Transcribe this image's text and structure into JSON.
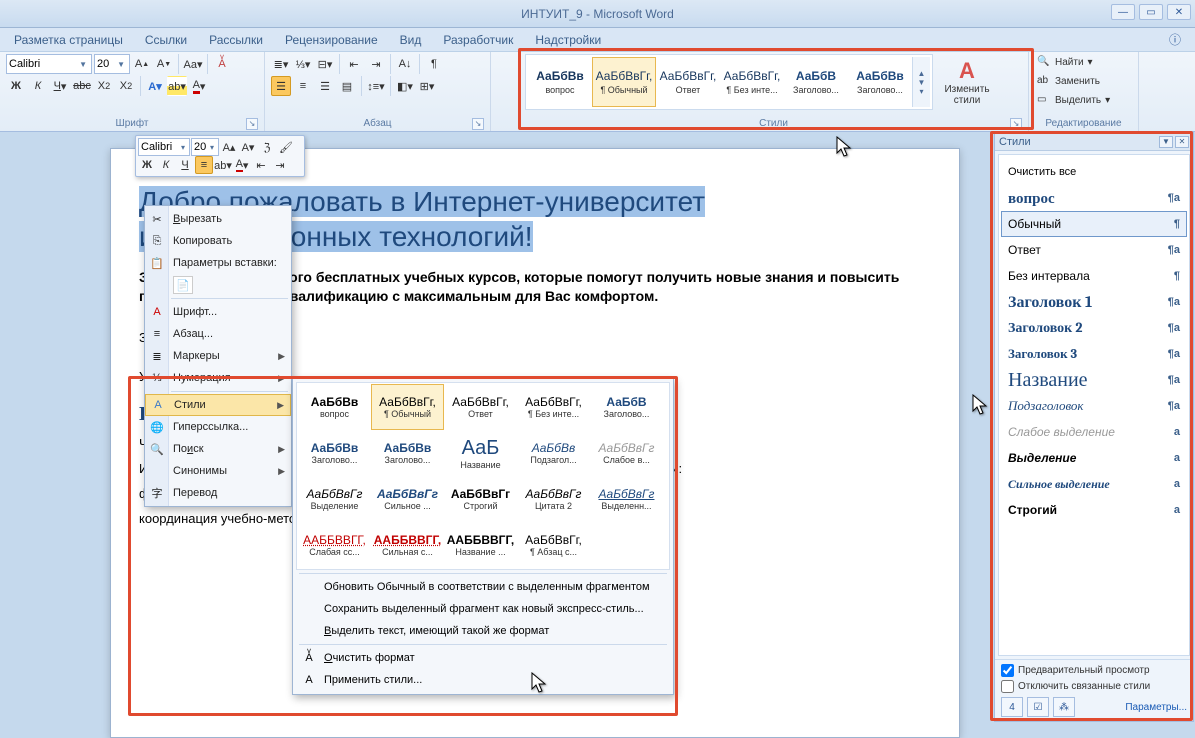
{
  "window": {
    "title": "ИНТУИТ_9 - Microsoft Word"
  },
  "menu": {
    "items": [
      "Разметка страницы",
      "Ссылки",
      "Рассылки",
      "Рецензирование",
      "Вид",
      "Разработчик",
      "Надстройки"
    ]
  },
  "ribbon": {
    "font": {
      "name": "Calibri",
      "size": "20",
      "group": "Шрифт"
    },
    "para": {
      "group": "Абзац"
    },
    "styles": {
      "group": "Стили",
      "items": [
        {
          "prev": "АаБбВв",
          "name": "вопрос",
          "cls": "bbold"
        },
        {
          "prev": "АаБбВвГг,",
          "name": "¶ Обычный",
          "sel": true
        },
        {
          "prev": "АаБбВвГг,",
          "name": "Ответ"
        },
        {
          "prev": "АаБбВвГг,",
          "name": "¶ Без инте..."
        },
        {
          "prev": "АаБбВ",
          "name": "Заголово...",
          "cls": "blue"
        },
        {
          "prev": "АаБбВв",
          "name": "Заголово...",
          "cls": "blue"
        }
      ],
      "change": "Изменить стили"
    },
    "edit": {
      "group": "Редактирование",
      "find": "Найти",
      "replace": "Заменить",
      "select": "Выделить"
    }
  },
  "minitb": {
    "font": "Calibri",
    "size": "20"
  },
  "ctxmenu": {
    "cut": "Вырезать",
    "copy": "Копировать",
    "pasteopt": "Параметры вставки:",
    "font": "Шрифт...",
    "para": "Абзац...",
    "bullets": "Маркеры",
    "numbering": "Нумерация",
    "styles": "Стили",
    "hyperlink": "Гиперссылка...",
    "search": "Поиск",
    "synonyms": "Синонимы",
    "translate": "Перевод"
  },
  "stylesub": {
    "row1": [
      {
        "p": "АаБбВв",
        "n": "вопрос",
        "cls": "fw-b"
      },
      {
        "p": "АаБбВвГг,",
        "n": "¶ Обычный",
        "sel": true
      },
      {
        "p": "АаБбВвГг,",
        "n": "Ответ"
      },
      {
        "p": "АаБбВвГг,",
        "n": "¶ Без инте..."
      },
      {
        "p": "АаБбВ",
        "n": "Заголово...",
        "cls": "c-blue fw-b"
      }
    ],
    "row2": [
      {
        "p": "АаБбВв",
        "n": "Заголово...",
        "cls": "c-blue fw-b"
      },
      {
        "p": "АаБбВв",
        "n": "Заголово...",
        "cls": "c-blue fw-b"
      },
      {
        "p": "АаБ",
        "n": "Название",
        "cls": "c-blue",
        "big": true
      },
      {
        "p": "АаБбВв",
        "n": "Подзагол...",
        "cls": "c-blue it"
      },
      {
        "p": "АаБбВвГг",
        "n": "Слабое в...",
        "cls": "it",
        "grey": true
      }
    ],
    "row3": [
      {
        "p": "АаБбВвГг",
        "n": "Выделение",
        "cls": "it"
      },
      {
        "p": "АаБбВвГг",
        "n": "Сильное ...",
        "cls": "c-blue fw-b it"
      },
      {
        "p": "АаБбВвГг",
        "n": "Строгий",
        "cls": "fw-b"
      },
      {
        "p": "АаБбВвГг",
        "n": "Цитата 2",
        "cls": "it"
      },
      {
        "p": "АаБбВвГг",
        "n": "Выделенн...",
        "cls": "ul c-blue"
      }
    ],
    "row4": [
      {
        "p": "ААББВВГГ,",
        "n": "Слабая сс...",
        "cls": "c-red",
        "under": true
      },
      {
        "p": "ААББВВГГ,",
        "n": "Сильная с...",
        "cls": "c-red fw-b",
        "under": true
      },
      {
        "p": "ААББВВГГ,",
        "n": "Название ...",
        "cls": "fw-b"
      },
      {
        "p": "АаБбВвГг,",
        "n": "¶ Абзац с..."
      }
    ],
    "update": "Обновить Обычный в соответствии с выделенным фрагментом",
    "saveas": "Сохранить выделенный фрагмент как новый экспресс-стиль...",
    "selsame": "Выделить текст, имеющий такой же формат",
    "clear": "Очистить формат",
    "apply": "Применить стили..."
  },
  "doc": {
    "h1a": "Добро пожаловать в Интернет-университет",
    "h1b": "информационных технологий!",
    "p1": "Здесь Вы найдете много бесплатных учебных курсов, которые помогут получить новые знания и повысить профессиональную квалификацию с максимальным для Вас комфортом.",
    "p2": "Зар",
    "p3": "Учи",
    "h2": "Информация о п",
    "p4": "Что такое Интернет-Универ",
    "p5": "Интернет-Университет Инф                                                                  авит следующие цели:",
    "p6": "финансирование разработ                                                                       ых технологий;",
    "p7": "координация учебно-метод"
  },
  "stylespane": {
    "title": "Стили",
    "clear": "Очистить все",
    "items": [
      {
        "n": "вопрос",
        "m": "¶a",
        "cls": "c-blue fw-b",
        "sz": "15px"
      },
      {
        "n": "Обычный",
        "m": "¶",
        "sel": true,
        "sz": "12px"
      },
      {
        "n": "Ответ",
        "m": "¶a",
        "sz": "12px"
      },
      {
        "n": "Без интервала",
        "m": "¶",
        "sz": "12px"
      },
      {
        "n": "Заголовок 1",
        "m": "¶a",
        "cls": "c-blue fw-b",
        "sz": "16px"
      },
      {
        "n": "Заголовок 2",
        "m": "¶a",
        "cls": "c-blue fw-b",
        "sz": "14px"
      },
      {
        "n": "Заголовок 3",
        "m": "¶a",
        "cls": "c-blue fw-b",
        "sz": "13px"
      },
      {
        "n": "Название",
        "m": "¶a",
        "cls": "c-blue",
        "sz": "20px"
      },
      {
        "n": "Подзаголовок",
        "m": "¶a",
        "cls": "c-blue it",
        "sz": "13px"
      },
      {
        "n": "Слабое выделение",
        "m": "a",
        "cls": "it",
        "grey": true,
        "sz": "12px"
      },
      {
        "n": "Выделение",
        "m": "a",
        "cls": "it fw-b",
        "sz": "12px"
      },
      {
        "n": "Сильное выделение",
        "m": "a",
        "cls": "c-blue it fw-b",
        "sz": "12px"
      },
      {
        "n": "Строгий",
        "m": "a",
        "cls": "fw-b",
        "sz": "12px"
      }
    ],
    "preview": "Предварительный просмотр",
    "linked": "Отключить связанные стили",
    "params": "Параметры..."
  }
}
